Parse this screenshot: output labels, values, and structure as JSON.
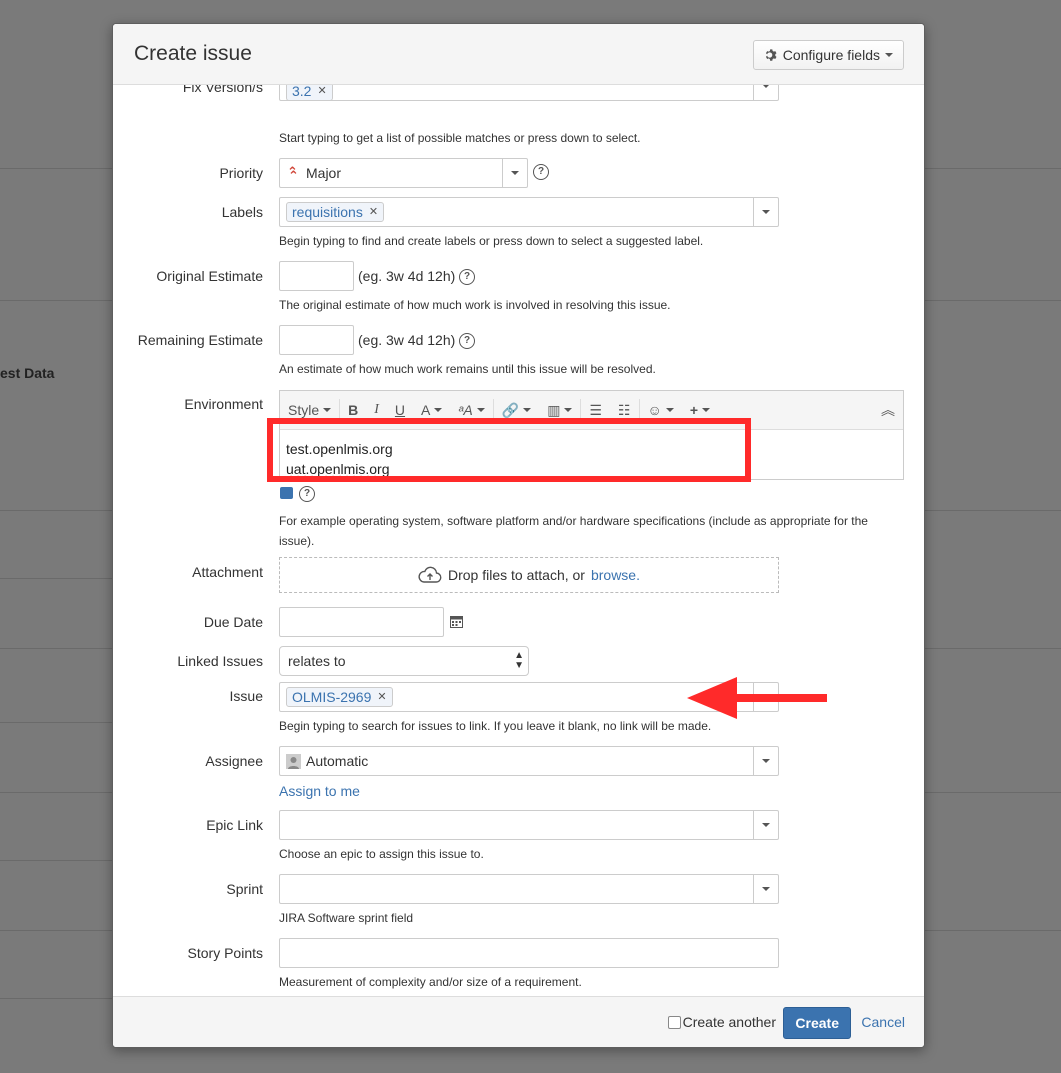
{
  "background": {
    "partial_text": "est Data"
  },
  "dialog": {
    "title": "Create issue",
    "configure_label": "Configure fields",
    "fields": {
      "fix_version": {
        "label": "Fix Version/s",
        "chip": "3.2",
        "help": "Start typing to get a list of possible matches or press down to select."
      },
      "priority": {
        "label": "Priority",
        "value": "Major"
      },
      "labels": {
        "label": "Labels",
        "chip": "requisitions",
        "help": "Begin typing to find and create labels or press down to select a suggested label."
      },
      "original_estimate": {
        "label": "Original Estimate",
        "hint": "(eg. 3w 4d 12h)",
        "help": "The original estimate of how much work is involved in resolving this issue."
      },
      "remaining_estimate": {
        "label": "Remaining Estimate",
        "hint": "(eg. 3w 4d 12h)",
        "help": "An estimate of how much work remains until this issue will be resolved."
      },
      "environment": {
        "label": "Environment",
        "style_label": "Style",
        "lines": [
          "test.openlmis.org",
          "uat.openlmis.org"
        ],
        "help": "For example operating system, software platform and/or hardware specifications (include as appropriate for the issue)."
      },
      "attachment": {
        "label": "Attachment",
        "drop_text": "Drop files to attach, or",
        "browse": "browse."
      },
      "due_date": {
        "label": "Due Date"
      },
      "linked_issues": {
        "label": "Linked Issues",
        "value": "relates to"
      },
      "issue": {
        "label": "Issue",
        "chip": "OLMIS-2969",
        "help": "Begin typing to search for issues to link. If you leave it blank, no link will be made."
      },
      "assignee": {
        "label": "Assignee",
        "value": "Automatic",
        "assign_to_me": "Assign to me"
      },
      "epic_link": {
        "label": "Epic Link",
        "help": "Choose an epic to assign this issue to."
      },
      "sprint": {
        "label": "Sprint",
        "help": "JIRA Software sprint field"
      },
      "story_points": {
        "label": "Story Points",
        "help": "Measurement of complexity and/or size of a requirement."
      }
    },
    "footer": {
      "create_another": "Create another",
      "create": "Create",
      "cancel": "Cancel"
    }
  },
  "colors": {
    "accent": "#3b73af",
    "highlight": "#ff2a2a",
    "priority_major": "#d04437"
  }
}
